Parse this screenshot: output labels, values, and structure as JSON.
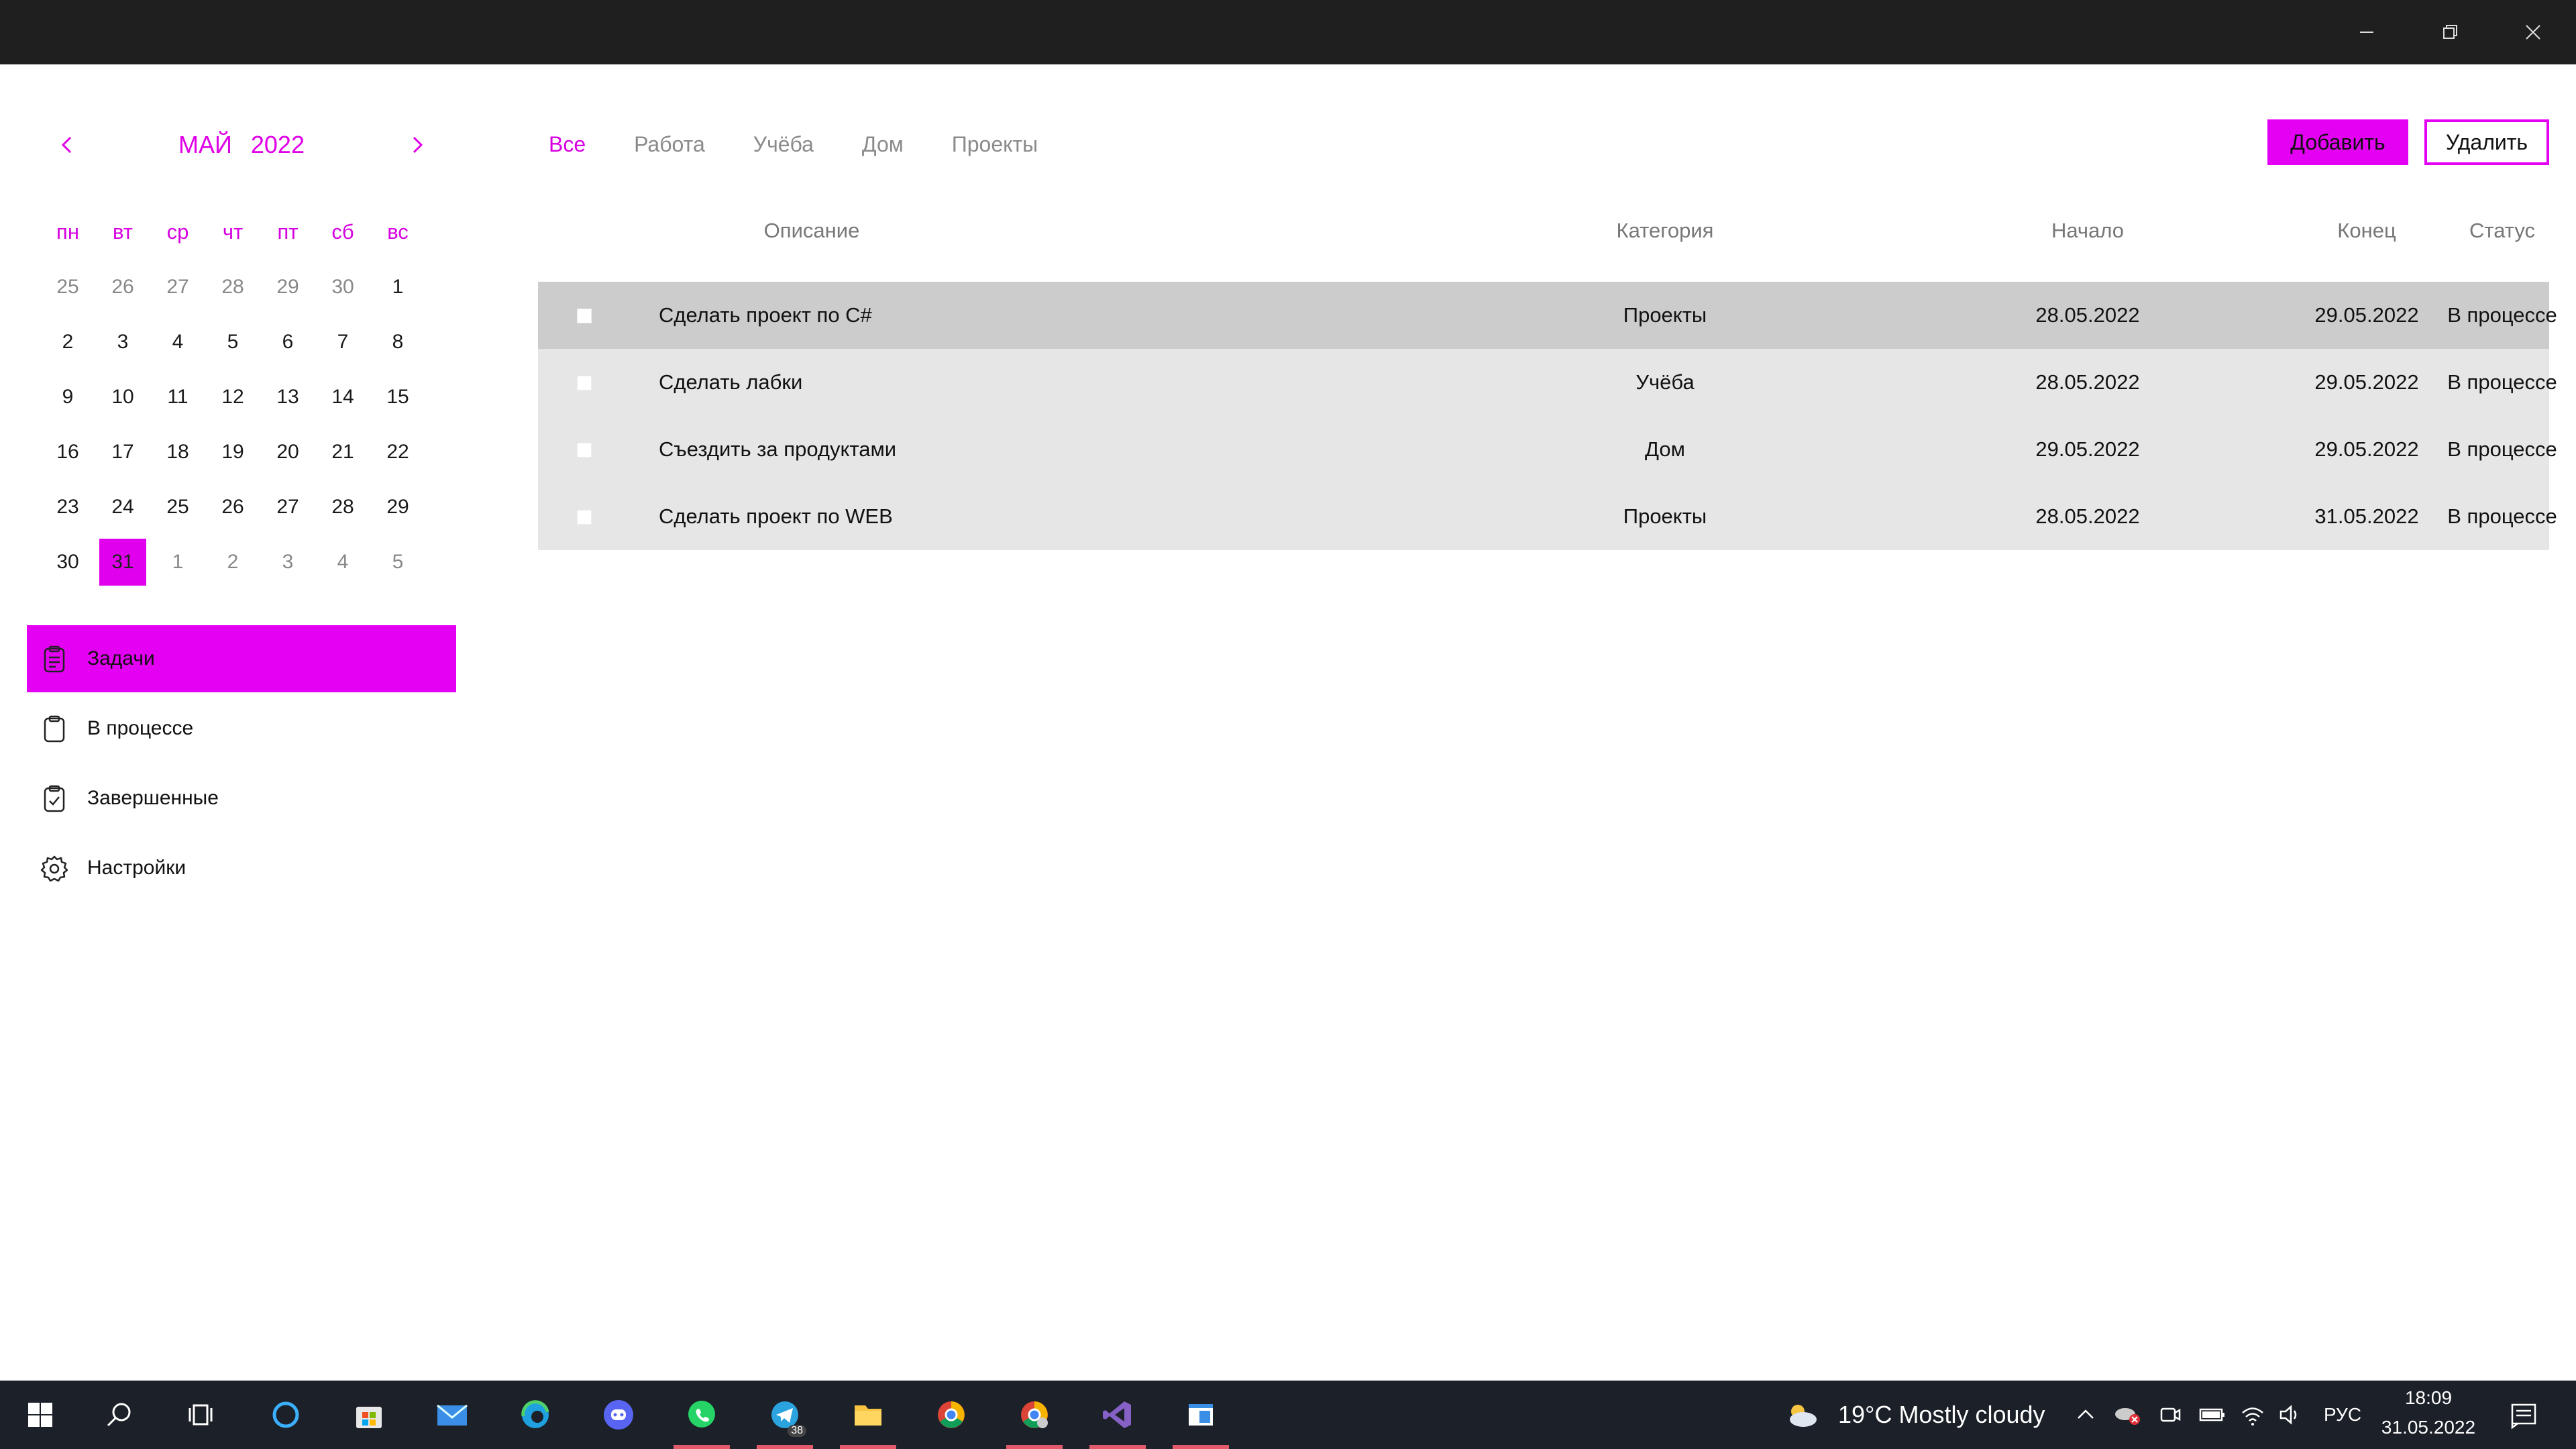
{
  "window": {
    "controls": {
      "minimize": "minimize-icon",
      "maximize": "restore-icon",
      "close": "close-icon"
    }
  },
  "calendar": {
    "month": "МАЙ",
    "year": "2022",
    "weekdays": [
      "пн",
      "вт",
      "ср",
      "чт",
      "пт",
      "сб",
      "вс"
    ],
    "weeks": [
      [
        "25",
        "26",
        "27",
        "28",
        "29",
        "30",
        "1"
      ],
      [
        "2",
        "3",
        "4",
        "5",
        "6",
        "7",
        "8"
      ],
      [
        "9",
        "10",
        "11",
        "12",
        "13",
        "14",
        "15"
      ],
      [
        "16",
        "17",
        "18",
        "19",
        "20",
        "21",
        "22"
      ],
      [
        "23",
        "24",
        "25",
        "26",
        "27",
        "28",
        "29"
      ],
      [
        "30",
        "31",
        "1",
        "2",
        "3",
        "4",
        "5"
      ]
    ],
    "selected": "31"
  },
  "nav": {
    "items": [
      {
        "label": "Задачи",
        "icon": "clipboard-list-icon"
      },
      {
        "label": "В процессе",
        "icon": "clipboard-icon"
      },
      {
        "label": "Завершенные",
        "icon": "clipboard-check-icon"
      },
      {
        "label": "Настройки",
        "icon": "gear-icon"
      }
    ]
  },
  "tabs": [
    "Все",
    "Работа",
    "Учёба",
    "Дом",
    "Проекты"
  ],
  "actions": {
    "add_label": "Добавить",
    "delete_label": "Удалить"
  },
  "table": {
    "headers": [
      "Описание",
      "Категория",
      "Начало",
      "Конец",
      "Статус"
    ],
    "rows": [
      {
        "description": "Сделать проект по C#",
        "category": "Проекты",
        "start": "28.05.2022",
        "end": "29.05.2022",
        "status": "В процессе"
      },
      {
        "description": "Сделать лабки",
        "category": "Учёба",
        "start": "28.05.2022",
        "end": "29.05.2022",
        "status": "В процессе"
      },
      {
        "description": "Съездить за продуктами",
        "category": "Дом",
        "start": "29.05.2022",
        "end": "29.05.2022",
        "status": "В процессе"
      },
      {
        "description": "Сделать проект по WEB",
        "category": "Проекты",
        "start": "28.05.2022",
        "end": "31.05.2022",
        "status": "В процессе"
      }
    ]
  },
  "taskbar": {
    "weather": "19°C  Mostly cloudy",
    "lang": "РУС",
    "time": "18:09",
    "date": "31.05.2022",
    "telegram_badge": "38",
    "accent": "#e400f2"
  }
}
